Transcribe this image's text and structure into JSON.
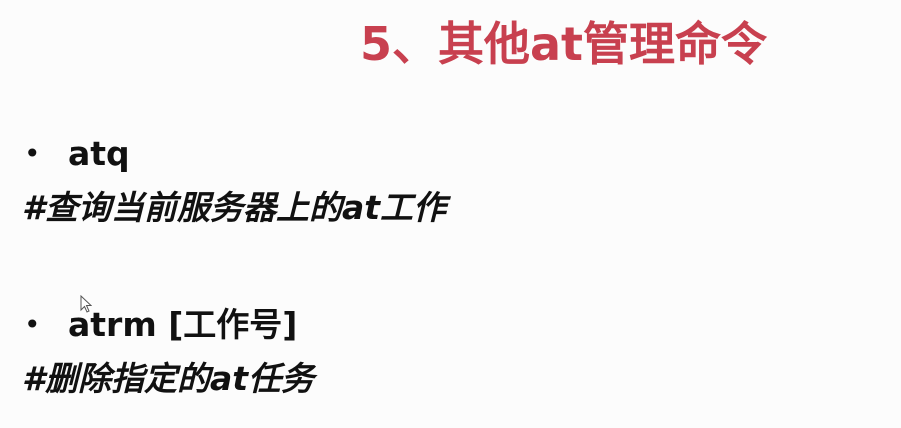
{
  "slide": {
    "title": "5、其他at管理命令",
    "items": [
      {
        "bullet": "•",
        "command": "atq",
        "comment": "#查询当前服务器上的at工作"
      },
      {
        "bullet": "•",
        "command": "atrm [工作号]",
        "comment": "#删除指定的at任务"
      }
    ]
  },
  "colors": {
    "background": "#fcfcfc",
    "title": "#c8404f",
    "text": "#111111"
  },
  "icons": {
    "cursor": "mouse-pointer-icon"
  }
}
